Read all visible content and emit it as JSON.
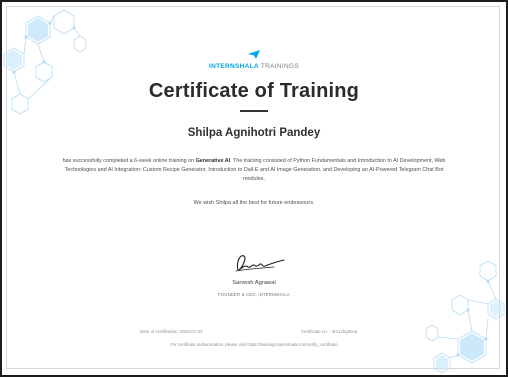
{
  "brand": {
    "name": "INTERNSHALA",
    "suffix": " TRAININGS",
    "color": "#00a5ec"
  },
  "certificate": {
    "title": "Certificate of Training",
    "recipient": "Shilpa Agnihotri Pandey",
    "description_before": "has successfully completed a 6-week online training on ",
    "course": "Generative AI",
    "description_after": ". The training consisted of Python Fundamentals and Introduction to AI Development, Web Technologies and AI Integration: Custom Recipe Generator, Introduction to Dall-E and AI Image Generation, and Developing an AI-Powered Telegram Chat Bot modules.",
    "wish": "We wish Shilpa all the best for future endeavours."
  },
  "signatory": {
    "name": "Sarvesh Agrawal",
    "role": "FOUNDER & CEO, INTERNSHALA"
  },
  "footer": {
    "date": "Date of certification: 2025-07-03",
    "certificate_no": "Certificate no. : 3m12bg8zep",
    "verification": "For certificate authentication, please visit https://trainings.internshala.com/verify_certificate"
  },
  "colors": {
    "border": "#1c1c1c",
    "pattern": "#b8dcf2",
    "hex_fill": "#c9e8fa",
    "text_dark": "#2b2b2b"
  },
  "icons": {
    "logo": "paper-plane-icon"
  }
}
